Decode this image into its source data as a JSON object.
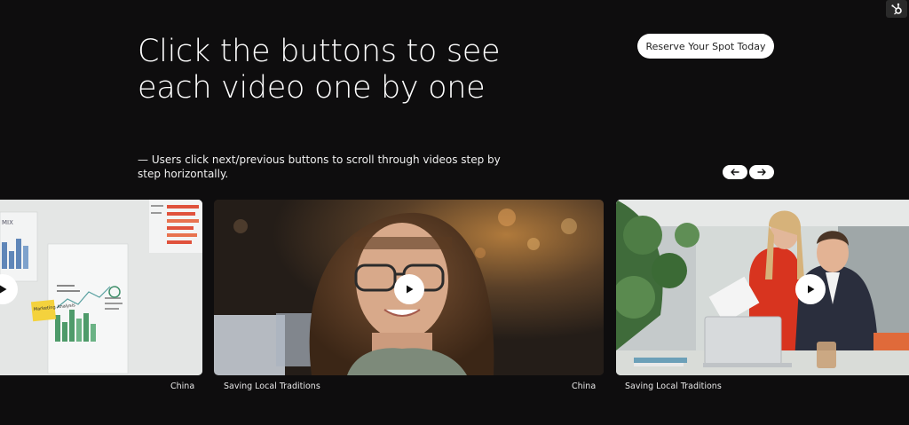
{
  "hero": {
    "headline": "Click the buttons to see each video one by one",
    "subtext": "— Users click next/previous buttons to scroll through videos step by step horizontally."
  },
  "header": {
    "cta_label": "Reserve Your Spot Today",
    "badge_icon": "hubspot-logo-icon"
  },
  "carousel": {
    "prev_icon": "arrow-left-icon",
    "next_icon": "arrow-right-icon",
    "captions": [
      {
        "location": "China",
        "title": "Saving Local Traditions"
      },
      {
        "location": "China",
        "title": "Saving Local Traditions"
      }
    ],
    "whiteboard_note": "Marketing Analysis",
    "whiteboard_word": "MIX"
  },
  "colors": {
    "background": "#0e0d0e",
    "button_bg": "#ffffff",
    "text": "#ffffff"
  }
}
